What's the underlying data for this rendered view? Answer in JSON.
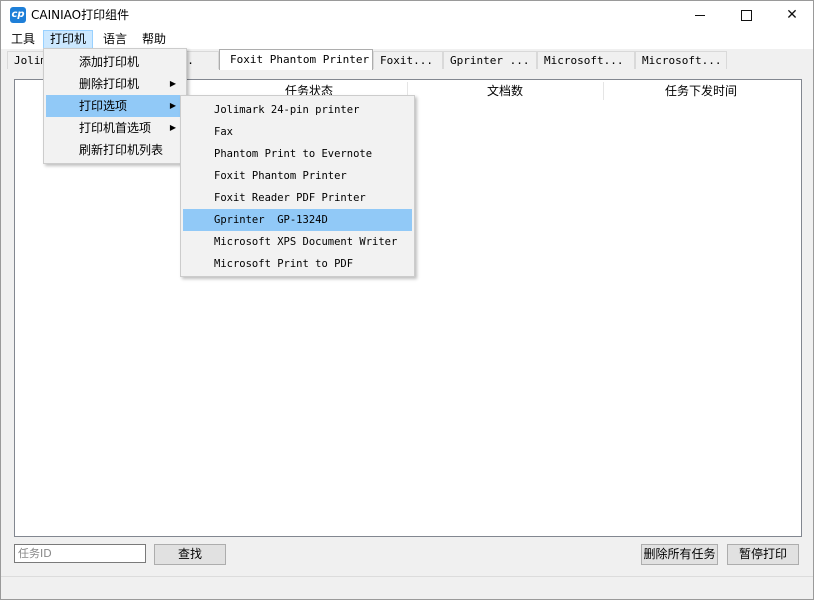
{
  "window": {
    "title": "CAINIAO打印组件",
    "icon_glyph": "cp",
    "accent": "#1e7fd8"
  },
  "menubar": {
    "items": [
      "工具",
      "打印机",
      "语言",
      "帮助"
    ],
    "open_index": 1
  },
  "tabs": {
    "items": [
      "Jolim",
      "...",
      "Foxit Phantom Printer",
      "Foxit...",
      "Gprinter ...",
      "Microsoft...",
      "Microsoft..."
    ],
    "active_index": 2
  },
  "table": {
    "columns": [
      "任务状态",
      "文档数",
      "任务下发时间"
    ]
  },
  "printer_menu": {
    "items": [
      {
        "label": "添加打印机",
        "submenu": false
      },
      {
        "label": "删除打印机",
        "submenu": true
      },
      {
        "label": "打印选项",
        "submenu": true
      },
      {
        "label": "打印机首选项",
        "submenu": true
      },
      {
        "label": "刷新打印机列表",
        "submenu": false
      }
    ],
    "highlighted_index": 2,
    "arrow_glyph": "▶"
  },
  "submenu": {
    "items": [
      "Jolimark 24-pin printer",
      "Fax",
      "Phantom Print to Evernote",
      "Foxit Phantom Printer",
      "Foxit Reader PDF Printer",
      "Gprinter  GP-1324D",
      "Microsoft XPS Document Writer",
      "Microsoft Print to PDF"
    ],
    "highlighted_index": 5,
    "highlight_color": "#91c9f7"
  },
  "search": {
    "placeholder": "任务ID",
    "value": "",
    "button_label": "查找"
  },
  "actions": {
    "delete_all_label": "删除所有任务",
    "pause_label": "暂停打印"
  }
}
